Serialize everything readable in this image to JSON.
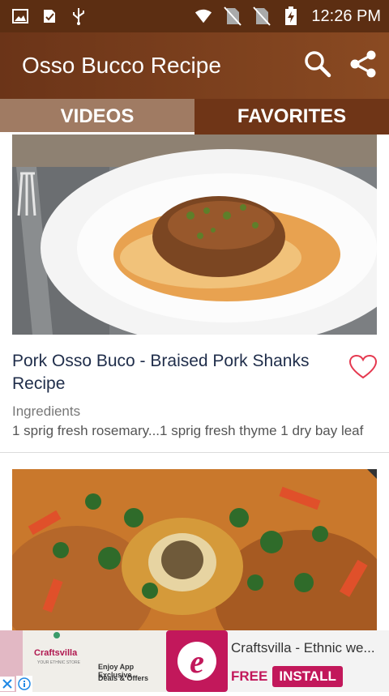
{
  "status_bar": {
    "time": "12:26 PM",
    "color": "#5c2e12"
  },
  "app_bar": {
    "title": "Osso Bucco Recipe",
    "color": "#7a3e1c",
    "search_icon": "search-icon",
    "share_icon": "share-icon"
  },
  "tabs": [
    {
      "label": "VIDEOS",
      "active": true
    },
    {
      "label": "FAVORITES",
      "active": false
    }
  ],
  "recipes": [
    {
      "title": "Pork Osso Buco - Braised Pork Shanks Recipe",
      "label": "Ingredients",
      "ingredients": "1 sprig fresh rosemary...1 sprig fresh thyme  1 dry bay leaf",
      "favorite": false
    },
    {
      "title": "",
      "label": "",
      "ingredients": ""
    }
  ],
  "ad": {
    "brand": "Craftsvilla",
    "brand_tagline": "YOUR ETHNIC STORE",
    "banner_text_1": "Enjoy App Exclusive",
    "banner_text_2": "Deals & Offers",
    "app_name": "Craftsvilla - Ethnic we...",
    "free_label": "FREE",
    "install_label": "INSTALL",
    "accent": "#c2185b"
  }
}
